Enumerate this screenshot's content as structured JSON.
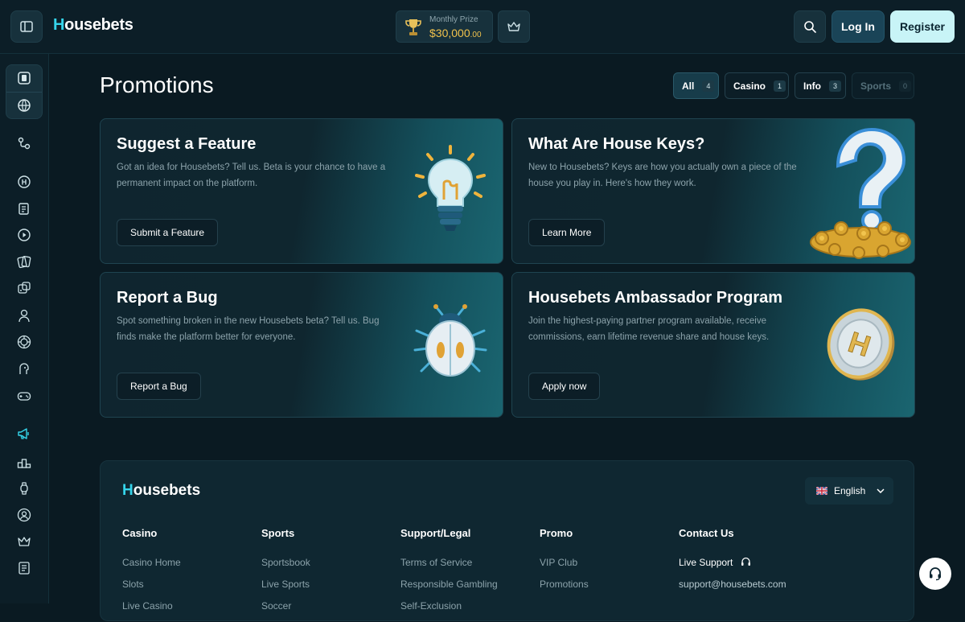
{
  "app": {
    "logo_first": "H",
    "logo_rest": "ousebets"
  },
  "header": {
    "prize_label": "Monthly Prize",
    "prize_amount": "$30,000",
    "prize_cents": ".00",
    "login": "Log In",
    "register": "Register"
  },
  "sidebar": {
    "icons": [
      "casino-chip-icon",
      "sports-ball-icon",
      "split-icon",
      "house-token-icon",
      "sportsbook-icon",
      "live-play-icon",
      "cards-icon",
      "dice-icon",
      "dealer-icon",
      "roulette-icon",
      "poker-face-icon",
      "gamepad-icon",
      "megaphone-icon",
      "leaderboard-icon",
      "watch-icon",
      "support-agent-icon",
      "crown-icon",
      "news-icon"
    ],
    "active": "megaphone-icon"
  },
  "page": {
    "title": "Promotions"
  },
  "filters": [
    {
      "label": "All",
      "count": "4"
    },
    {
      "label": "Casino",
      "count": "1"
    },
    {
      "label": "Info",
      "count": "3"
    },
    {
      "label": "Sports",
      "count": "0"
    }
  ],
  "cards": [
    {
      "title": "Suggest a Feature",
      "desc": "Got an idea for Housebets? Tell us. Beta is your chance to have a permanent impact on the platform.",
      "button": "Submit a Feature",
      "art": "lightbulb-illustration"
    },
    {
      "title": "What Are House Keys?",
      "desc": "New to Housebets? Keys are how you actually own a piece of the house you play in. Here's how they work.",
      "button": "Learn More",
      "art": "question-keys-illustration"
    },
    {
      "title": "Report a Bug",
      "desc": "Spot something broken in the new Housebets beta? Tell us. Bug finds make the platform better for everyone.",
      "button": "Report a Bug",
      "art": "bug-illustration"
    },
    {
      "title": "Housebets Ambassador Program",
      "desc": "Join the highest-paying partner program available, receive commissions, earn lifetime revenue share and house keys.",
      "button": "Apply now",
      "art": "h-chip-illustration"
    }
  ],
  "footer": {
    "logo_first": "H",
    "logo_rest": "ousebets",
    "language": "English",
    "columns": [
      {
        "heading": "Casino",
        "links": [
          "Casino Home",
          "Slots",
          "Live Casino"
        ]
      },
      {
        "heading": "Sports",
        "links": [
          "Sportsbook",
          "Live Sports",
          "Soccer"
        ]
      },
      {
        "heading": "Support/Legal",
        "links": [
          "Terms of Service",
          "Responsible Gambling",
          "Self-Exclusion"
        ]
      },
      {
        "heading": "Promo",
        "links": [
          "VIP Club",
          "Promotions"
        ]
      },
      {
        "heading": "Contact Us",
        "links": [
          "Live Support",
          "support@housebets.com"
        ]
      }
    ]
  },
  "colors": {
    "accent": "#35d4ea",
    "gold": "#f0c24c",
    "background": "#0a1a22"
  }
}
